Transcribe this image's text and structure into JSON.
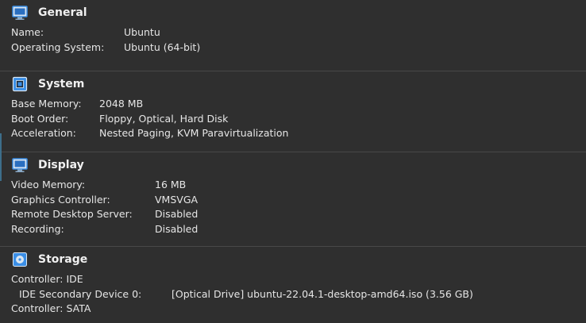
{
  "general": {
    "title": "General",
    "icon": "monitor-icon",
    "rows": [
      {
        "label": "Name:",
        "value": "Ubuntu"
      },
      {
        "label": "Operating System:",
        "value": "Ubuntu (64-bit)"
      }
    ]
  },
  "system": {
    "title": "System",
    "icon": "chip-icon",
    "rows": [
      {
        "label": "Base Memory:",
        "value": "2048 MB"
      },
      {
        "label": "Boot Order:",
        "value": "Floppy, Optical, Hard Disk"
      },
      {
        "label": "Acceleration:",
        "value": "Nested Paging, KVM Paravirtualization"
      }
    ]
  },
  "display": {
    "title": "Display",
    "icon": "display-icon",
    "rows": [
      {
        "label": "Video Memory:",
        "value": "16 MB"
      },
      {
        "label": "Graphics Controller:",
        "value": "VMSVGA"
      },
      {
        "label": "Remote Desktop Server:",
        "value": "Disabled"
      },
      {
        "label": "Recording:",
        "value": "Disabled"
      }
    ]
  },
  "storage": {
    "title": "Storage",
    "icon": "disk-icon",
    "controller_ide": "Controller: IDE",
    "ide_device_label": "IDE Secondary Device 0:",
    "ide_device_value": "[Optical Drive] ubuntu-22.04.1-desktop-amd64.iso (3.56 GB)",
    "controller_sata": "Controller: SATA"
  },
  "colors": {
    "background": "#2f2f2f",
    "text": "#e6e6e6",
    "divider": "#484848",
    "icon_blue": "#3a8ee6"
  }
}
